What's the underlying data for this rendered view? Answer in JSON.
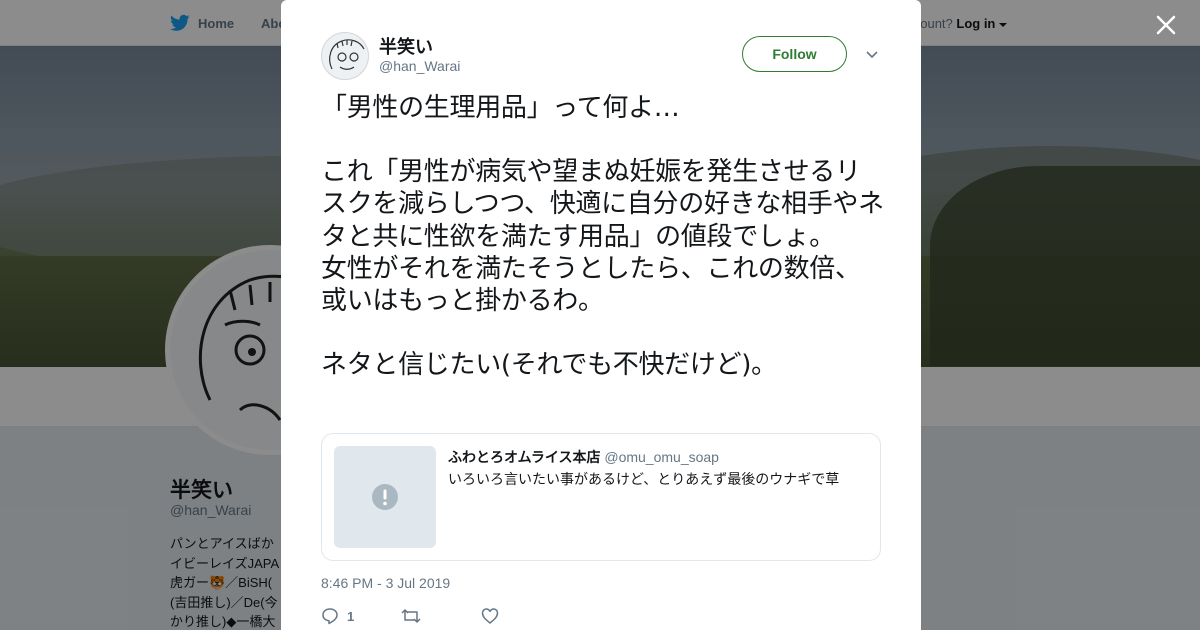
{
  "topnav": {
    "home_label": "Home",
    "about_label": "Abo",
    "account_prompt": "account?",
    "login_label": "Log in"
  },
  "profile": {
    "name": "半笑い",
    "handle": "@han_Warai",
    "bio": "パンとアイスばか\nイビーレイズJAPA\n虎ガー🐯／BiSH(\n(吉田推し)／De(今\nかり推し)◆一橋大"
  },
  "tweet": {
    "author_name": "半笑い",
    "author_handle": "@han_Warai",
    "follow_label": "Follow",
    "paragraphs": [
      "「男性の生理用品」って何よ…",
      "これ「男性が病気や望まぬ妊娠を発生させるリスクを減らしつつ、快適に自分の好きな相手やネタと共に性欲を満たす用品」の値段でしょ。\n女性がそれを満たそうとしたら、これの数倍、或いはもっと掛かるわ。",
      "ネタと信じたい(それでも不快だけど)。"
    ],
    "quote": {
      "name": "ふわとろオムライス本店",
      "handle": "@omu_omu_soap",
      "text": "いろいろ言いたい事があるけど、とりあえず最後のウナギで草"
    },
    "timestamp": "8:46 PM - 3 Jul 2019",
    "reply_count": "1"
  },
  "icons": {
    "bird": "twitter-bird-icon",
    "close": "close-icon",
    "caret": "chevron-down-icon",
    "reply": "reply-icon",
    "retweet": "retweet-icon",
    "like": "heart-icon",
    "media_missing": "exclamation-icon"
  },
  "colors": {
    "accent": "#1da1f2",
    "follow": "#2e7d32",
    "muted": "#657786"
  }
}
